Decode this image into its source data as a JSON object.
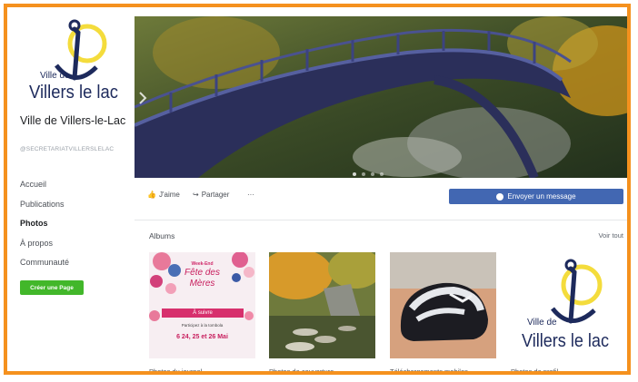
{
  "page": {
    "name": "Ville de Villers-le-Lac",
    "handle": "@SECRETARIATVILLERSLELAC",
    "logo_text_top": "Ville de",
    "logo_text_bottom": "Villers le lac"
  },
  "nav": [
    {
      "label": "Accueil",
      "active": false
    },
    {
      "label": "Publications",
      "active": false
    },
    {
      "label": "Photos",
      "active": true
    },
    {
      "label": "À propos",
      "active": false
    },
    {
      "label": "Communauté",
      "active": false
    }
  ],
  "create_page_label": "Créer une Page",
  "actions": {
    "like": "J'aime",
    "share": "Partager",
    "more": "···",
    "message": "Envoyer un message"
  },
  "albums": {
    "title": "Albums",
    "see_all": "Voir tout",
    "items": [
      {
        "caption": "Photos du journal",
        "sub": "",
        "poster": {
          "line1": "Week-End",
          "line2": "Fête des",
          "line3": "Mères",
          "line4": "À suivre",
          "line5": "Participez à la tombola",
          "line6": "6 24, 25 et 26 Mai"
        }
      },
      {
        "caption": "Photos de couverture",
        "sub": ""
      },
      {
        "caption": "Téléchargements mobiles",
        "sub": ""
      },
      {
        "caption": "Photos de profil",
        "sub": ""
      }
    ]
  },
  "colors": {
    "frame": "#f5911e",
    "brand_blue": "#4267b2",
    "green": "#42b72a",
    "logo_navy": "#1d2a5c",
    "logo_yellow": "#f4dc3c"
  }
}
